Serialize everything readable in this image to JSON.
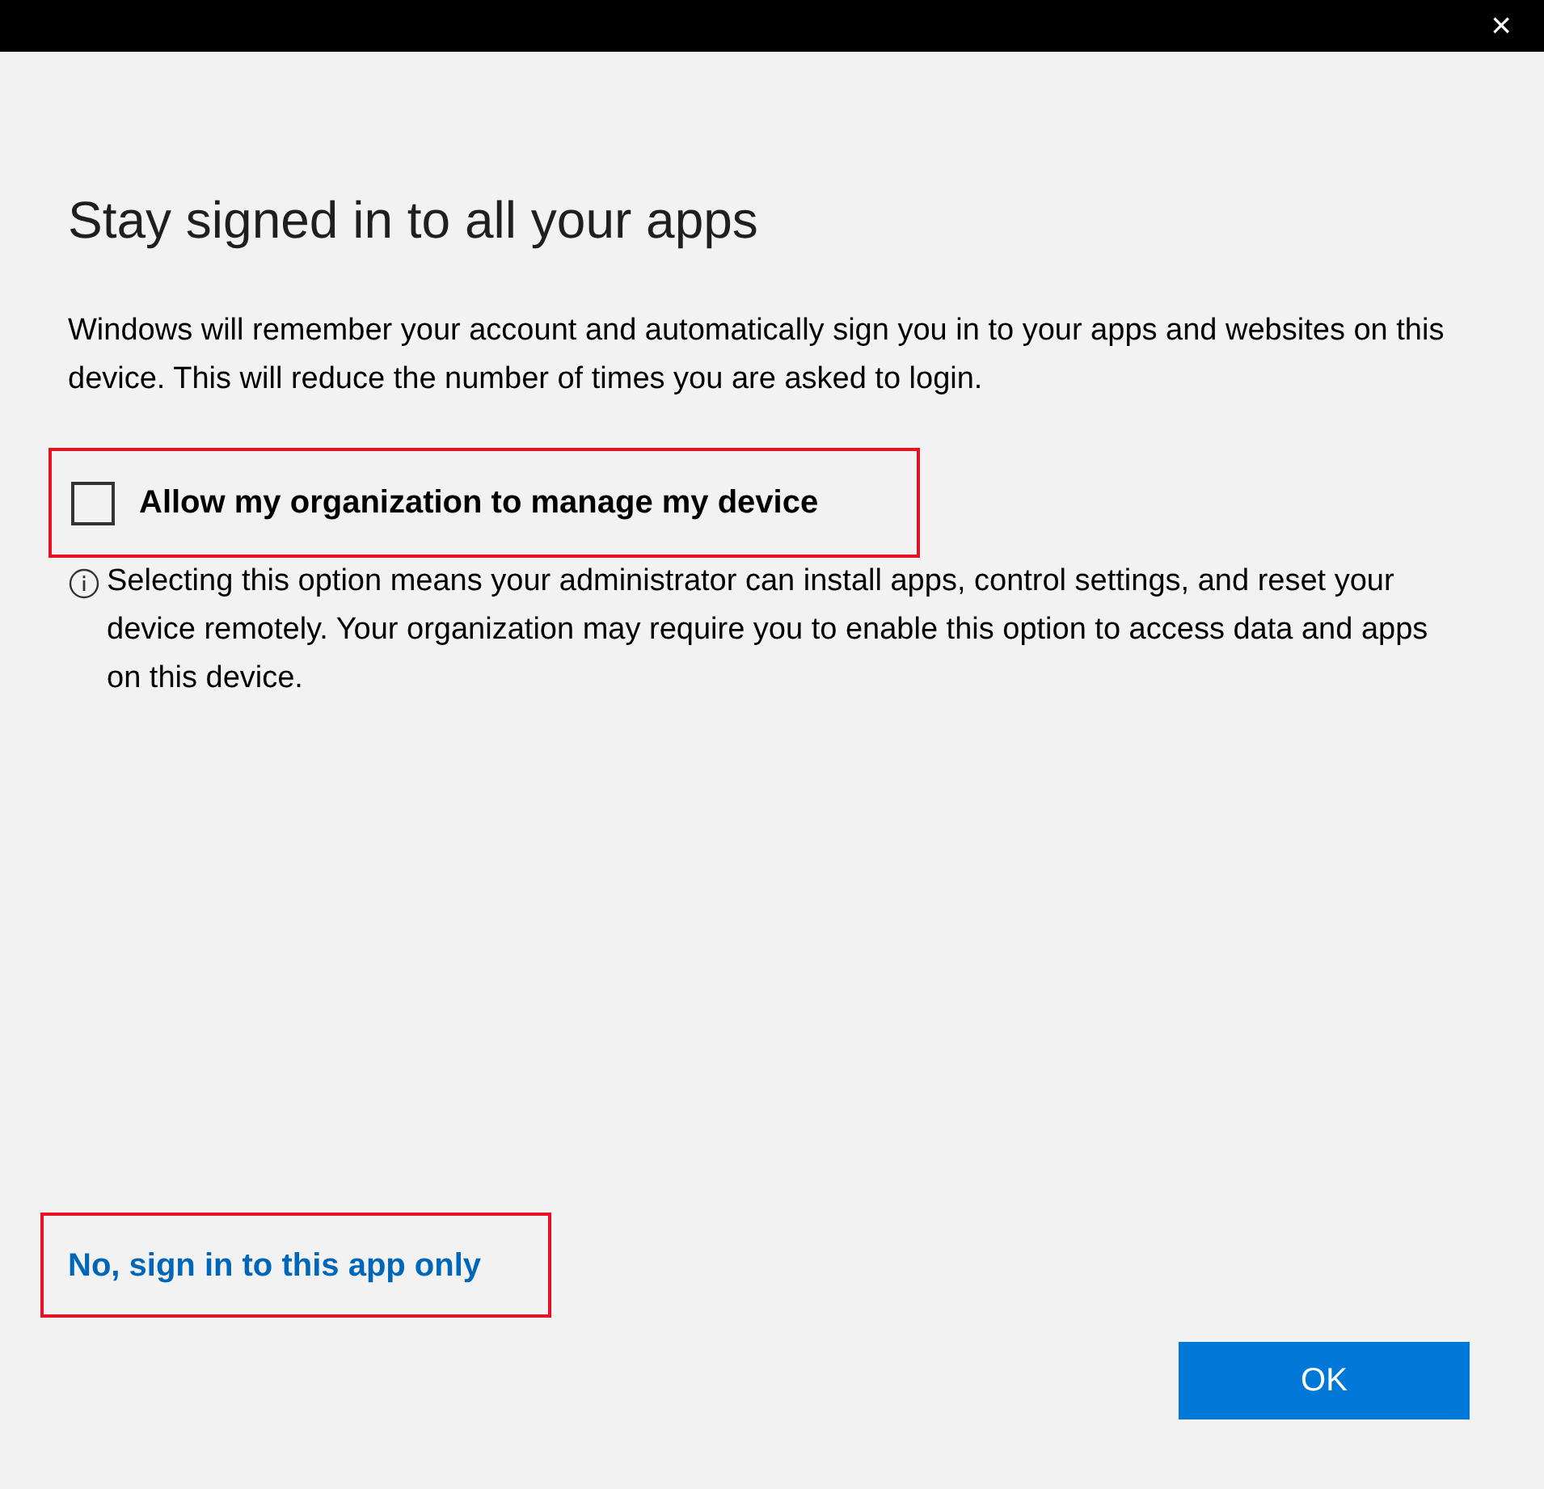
{
  "window": {
    "close": "×"
  },
  "title": "Stay signed in to all your apps",
  "description": "Windows will remember your account and automatically sign you in to your apps and websites on this device. This will reduce the number of times you are asked to login.",
  "option": {
    "label": "Allow my organization to manage my device",
    "checked": false,
    "highlighted": true
  },
  "info": "Selecting this option means your administrator can install apps, control settings, and reset your device remotely. Your organization may require you to enable this option to access data and apps on this device.",
  "link": {
    "label": "No, sign in to this app only",
    "highlighted": true
  },
  "buttons": [
    "OK"
  ]
}
